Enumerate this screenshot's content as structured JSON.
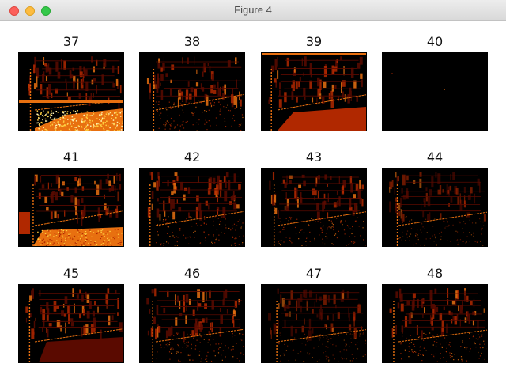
{
  "window": {
    "title": "Figure 4"
  },
  "figure": {
    "subplots": [
      {
        "title": "37",
        "style": "bright-ground"
      },
      {
        "title": "38",
        "style": "facade"
      },
      {
        "title": "39",
        "style": "ground-red"
      },
      {
        "title": "40",
        "style": "dark"
      },
      {
        "title": "41",
        "style": "ground-orange"
      },
      {
        "title": "42",
        "style": "facade"
      },
      {
        "title": "43",
        "style": "facade"
      },
      {
        "title": "44",
        "style": "facade-dim"
      },
      {
        "title": "45",
        "style": "ground-dark-red"
      },
      {
        "title": "46",
        "style": "facade"
      },
      {
        "title": "47",
        "style": "facade-dim"
      },
      {
        "title": "48",
        "style": "facade"
      }
    ],
    "colormap": "hot",
    "colors": {
      "background": "#000000",
      "dark_red": "#5a0a00",
      "red": "#b02800",
      "orange": "#e87010",
      "yellow": "#ffd040",
      "white_hot": "#fff2b0"
    }
  }
}
